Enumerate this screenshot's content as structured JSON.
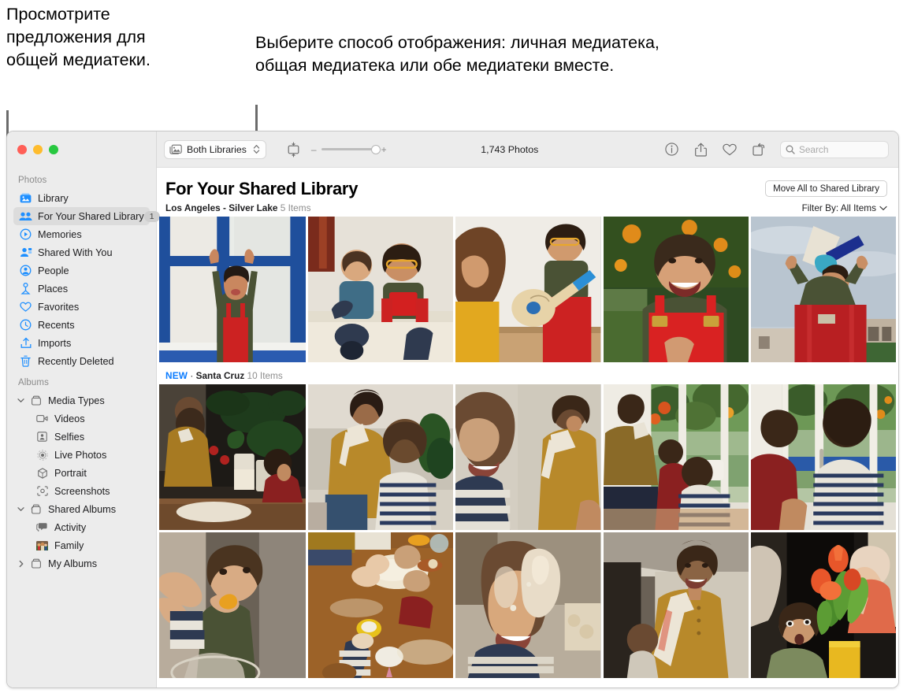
{
  "annotations": {
    "left": "Просмотрите предложения для общей медиатеки.",
    "right": "Выберите способ отображения: личная медиатека, общая медиатека или обе медиатеки вместе."
  },
  "window": {
    "traffic_lights": [
      "close",
      "minimize",
      "zoom"
    ]
  },
  "toolbar": {
    "library_popup": {
      "label": "Both Libraries",
      "icon": "photos-stack-icon"
    },
    "view_button_icon": "aspect-fit-icon",
    "zoom_out": "–",
    "zoom_in": "+",
    "photo_count": "1,743 Photos",
    "icons": [
      {
        "name": "info-icon",
        "glyph": "ⓘ"
      },
      {
        "name": "share-icon",
        "glyph": "share"
      },
      {
        "name": "favorite-icon",
        "glyph": "heart"
      },
      {
        "name": "rotate-icon",
        "glyph": "rotate"
      }
    ],
    "search": {
      "placeholder": "Search",
      "value": "",
      "icon": "search-icon"
    }
  },
  "sidebar": {
    "sections": [
      {
        "title": "Photos",
        "items": [
          {
            "label": "Library",
            "icon": "photos-library-icon",
            "selected": false,
            "badge": ""
          },
          {
            "label": "For Your Shared Library",
            "icon": "shared-people-icon",
            "selected": true,
            "badge": "1"
          },
          {
            "label": "Memories",
            "icon": "memories-icon",
            "selected": false,
            "badge": ""
          },
          {
            "label": "Shared With You",
            "icon": "shared-with-you-icon",
            "selected": false,
            "badge": ""
          },
          {
            "label": "People",
            "icon": "people-icon",
            "selected": false,
            "badge": ""
          },
          {
            "label": "Places",
            "icon": "places-pin-icon",
            "selected": false,
            "badge": ""
          },
          {
            "label": "Favorites",
            "icon": "heart-icon",
            "selected": false,
            "badge": ""
          },
          {
            "label": "Recents",
            "icon": "clock-icon",
            "selected": false,
            "badge": ""
          },
          {
            "label": "Imports",
            "icon": "import-icon",
            "selected": false,
            "badge": ""
          },
          {
            "label": "Recently Deleted",
            "icon": "trash-icon",
            "selected": false,
            "badge": ""
          }
        ]
      },
      {
        "title": "Albums",
        "items": [
          {
            "label": "Media Types",
            "icon": "album-icon",
            "group": true,
            "expanded": true,
            "child": false
          },
          {
            "label": "Videos",
            "icon": "video-icon",
            "group": false,
            "child": true
          },
          {
            "label": "Selfies",
            "icon": "selfie-icon",
            "group": false,
            "child": true
          },
          {
            "label": "Live Photos",
            "icon": "live-photo-icon",
            "group": false,
            "child": true
          },
          {
            "label": "Portrait",
            "icon": "portrait-icon",
            "group": false,
            "child": true
          },
          {
            "label": "Screenshots",
            "icon": "screenshot-icon",
            "group": false,
            "child": true
          },
          {
            "label": "Shared Albums",
            "icon": "shared-album-icon",
            "group": true,
            "expanded": true,
            "child": false
          },
          {
            "label": "Activity",
            "icon": "activity-icon",
            "group": false,
            "child": true
          },
          {
            "label": "Family",
            "icon": "family-thumb-icon",
            "group": false,
            "child": true
          },
          {
            "label": "My Albums",
            "icon": "album-icon",
            "group": true,
            "expanded": false,
            "child": false
          }
        ]
      }
    ]
  },
  "content": {
    "page_title": "For Your Shared Library",
    "move_all_button": "Move All to Shared Library",
    "filter_label": "Filter By: All Items",
    "sections": [
      {
        "new_tag": "",
        "place": "Los Angeles - Silver Lake",
        "item_count": "5 Items",
        "rows": [
          [
            {
              "name": "child-waving-at-window",
              "widths": 188
            },
            {
              "name": "two-boys-on-bed-with-toy",
              "widths": 186
            },
            {
              "name": "girl-and-boy-with-ukulele",
              "widths": 186
            },
            {
              "name": "smiling-boy-red-overalls",
              "widths": 186
            },
            {
              "name": "boy-with-megaphone-sky",
              "widths": 186
            }
          ]
        ]
      },
      {
        "new_tag": "NEW",
        "place": "Santa Cruz",
        "item_count": "10 Items",
        "rows": [
          [
            {
              "name": "woman-baking-with-child-plants",
              "widths": 188
            },
            {
              "name": "woman-and-boy-at-counter",
              "widths": 186
            },
            {
              "name": "boy-laughing-with-mother",
              "widths": 186
            },
            {
              "name": "family-at-window-kneading",
              "widths": 186
            },
            {
              "name": "two-boys-at-window-dough",
              "widths": 186
            }
          ],
          [
            {
              "name": "boy-eating-with-adult-hand",
              "widths": 188
            },
            {
              "name": "hands-kneading-dough-table",
              "widths": 186
            },
            {
              "name": "boy-floury-hands-on-face",
              "widths": 186
            },
            {
              "name": "woman-smiling-with-towel",
              "widths": 186
            },
            {
              "name": "boy-with-tulips-and-baby",
              "widths": 186
            }
          ]
        ]
      }
    ]
  },
  "colors": {
    "accent_blue": "#0a7bff",
    "sidebar_bg": "#ececec",
    "selected_row": "#dcdcdc",
    "toolbar_bg": "#ececec",
    "leader_line": "#6b6b6b"
  }
}
